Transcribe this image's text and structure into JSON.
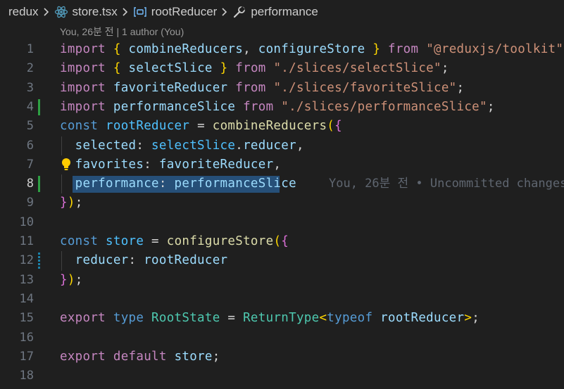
{
  "breadcrumb": {
    "items": [
      {
        "label": "redux",
        "icon": "folder"
      },
      {
        "label": "store.tsx",
        "icon": "react-icon"
      },
      {
        "label": "rootReducer",
        "icon": "variable-icon"
      },
      {
        "label": "performance",
        "icon": "wrench-icon"
      }
    ]
  },
  "codelens": "You, 26분 전 | 1 author (You)",
  "blame": "You, 26분 전 • Uncommitted changes",
  "colors": {
    "keyword": "#c586c0",
    "storage": "#569cd6",
    "variable": "#9cdcfe",
    "const": "#4fc1ff",
    "function": "#dcdcaa",
    "type": "#4ec9b0",
    "string": "#ce9178",
    "selection": "#264f78",
    "git_added": "#2ea043",
    "git_modified": "#1b81a8"
  },
  "lines": [
    {
      "n": "1",
      "tokens": [
        {
          "t": "import",
          "c": "k"
        },
        {
          "t": " ",
          "c": "p"
        },
        {
          "t": "{",
          "c": "b1"
        },
        {
          "t": " ",
          "c": "p"
        },
        {
          "t": "combineReducers",
          "c": "v"
        },
        {
          "t": ", ",
          "c": "p"
        },
        {
          "t": "configureStore",
          "c": "v"
        },
        {
          "t": " ",
          "c": "p"
        },
        {
          "t": "}",
          "c": "b1"
        },
        {
          "t": " ",
          "c": "p"
        },
        {
          "t": "from",
          "c": "k"
        },
        {
          "t": " ",
          "c": "p"
        },
        {
          "t": "\"@reduxjs/toolkit\"",
          "c": "str"
        },
        {
          "t": ";",
          "c": "p"
        }
      ]
    },
    {
      "n": "2",
      "tokens": [
        {
          "t": "import",
          "c": "k"
        },
        {
          "t": " ",
          "c": "p"
        },
        {
          "t": "{",
          "c": "b1"
        },
        {
          "t": " ",
          "c": "p"
        },
        {
          "t": "selectSlice",
          "c": "v"
        },
        {
          "t": " ",
          "c": "p"
        },
        {
          "t": "}",
          "c": "b1"
        },
        {
          "t": " ",
          "c": "p"
        },
        {
          "t": "from",
          "c": "k"
        },
        {
          "t": " ",
          "c": "p"
        },
        {
          "t": "\"./slices/selectSlice\"",
          "c": "str"
        },
        {
          "t": ";",
          "c": "p"
        }
      ]
    },
    {
      "n": "3",
      "tokens": [
        {
          "t": "import",
          "c": "k"
        },
        {
          "t": " ",
          "c": "p"
        },
        {
          "t": "favoriteReducer",
          "c": "v"
        },
        {
          "t": " ",
          "c": "p"
        },
        {
          "t": "from",
          "c": "k"
        },
        {
          "t": " ",
          "c": "p"
        },
        {
          "t": "\"./slices/favoriteSlice\"",
          "c": "str"
        },
        {
          "t": ";",
          "c": "p"
        }
      ]
    },
    {
      "n": "4",
      "decor": "added",
      "tokens": [
        {
          "t": "import",
          "c": "k"
        },
        {
          "t": " ",
          "c": "p"
        },
        {
          "t": "performanceSlice",
          "c": "v"
        },
        {
          "t": " ",
          "c": "p"
        },
        {
          "t": "from",
          "c": "k"
        },
        {
          "t": " ",
          "c": "p"
        },
        {
          "t": "\"./slices/performanceSlice\"",
          "c": "str"
        },
        {
          "t": ";",
          "c": "p"
        }
      ]
    },
    {
      "n": "5",
      "tokens": [
        {
          "t": "const",
          "c": "s"
        },
        {
          "t": " ",
          "c": "p"
        },
        {
          "t": "rootReducer",
          "c": "c"
        },
        {
          "t": " = ",
          "c": "p"
        },
        {
          "t": "combineReducers",
          "c": "f"
        },
        {
          "t": "(",
          "c": "b1"
        },
        {
          "t": "{",
          "c": "b2"
        }
      ]
    },
    {
      "n": "6",
      "guide": true,
      "tokens": [
        {
          "t": "  ",
          "c": "p"
        },
        {
          "t": "selected",
          "c": "v"
        },
        {
          "t": ": ",
          "c": "p"
        },
        {
          "t": "selectSlice",
          "c": "c"
        },
        {
          "t": ".",
          "c": "p"
        },
        {
          "t": "reducer",
          "c": "v"
        },
        {
          "t": ",",
          "c": "p"
        }
      ]
    },
    {
      "n": "7",
      "bulb": true,
      "tokens": [
        {
          "t": "  ",
          "c": "p"
        },
        {
          "t": "favorites",
          "c": "v"
        },
        {
          "t": ": ",
          "c": "p"
        },
        {
          "t": "favoriteReducer",
          "c": "v"
        },
        {
          "t": ",",
          "c": "p"
        }
      ]
    },
    {
      "n": "8",
      "decor": "added",
      "active": true,
      "selection": true,
      "blame": true,
      "guide": true,
      "tokens": [
        {
          "t": "  ",
          "c": "p"
        },
        {
          "t": "performance",
          "c": "v"
        },
        {
          "t": ": ",
          "c": "p"
        },
        {
          "t": "performanceSlice",
          "c": "v"
        }
      ]
    },
    {
      "n": "9",
      "tokens": [
        {
          "t": "}",
          "c": "b2"
        },
        {
          "t": ")",
          "c": "b1"
        },
        {
          "t": ";",
          "c": "p"
        }
      ]
    },
    {
      "n": "10",
      "tokens": []
    },
    {
      "n": "11",
      "tokens": [
        {
          "t": "const",
          "c": "s"
        },
        {
          "t": " ",
          "c": "p"
        },
        {
          "t": "store",
          "c": "c"
        },
        {
          "t": " = ",
          "c": "p"
        },
        {
          "t": "configureStore",
          "c": "f"
        },
        {
          "t": "(",
          "c": "b1"
        },
        {
          "t": "{",
          "c": "b2"
        }
      ]
    },
    {
      "n": "12",
      "decor": "modified",
      "guide": true,
      "tokens": [
        {
          "t": "  ",
          "c": "p"
        },
        {
          "t": "reducer",
          "c": "v"
        },
        {
          "t": ": ",
          "c": "p"
        },
        {
          "t": "rootReducer",
          "c": "v"
        }
      ]
    },
    {
      "n": "13",
      "tokens": [
        {
          "t": "}",
          "c": "b2"
        },
        {
          "t": ")",
          "c": "b1"
        },
        {
          "t": ";",
          "c": "p"
        }
      ]
    },
    {
      "n": "14",
      "tokens": []
    },
    {
      "n": "15",
      "tokens": [
        {
          "t": "export",
          "c": "k"
        },
        {
          "t": " ",
          "c": "p"
        },
        {
          "t": "type",
          "c": "s"
        },
        {
          "t": " ",
          "c": "p"
        },
        {
          "t": "RootState",
          "c": "t"
        },
        {
          "t": " = ",
          "c": "p"
        },
        {
          "t": "ReturnType",
          "c": "t"
        },
        {
          "t": "<",
          "c": "b1"
        },
        {
          "t": "typeof",
          "c": "s"
        },
        {
          "t": " ",
          "c": "p"
        },
        {
          "t": "rootReducer",
          "c": "v"
        },
        {
          "t": ">",
          "c": "b1"
        },
        {
          "t": ";",
          "c": "p"
        }
      ]
    },
    {
      "n": "16",
      "tokens": []
    },
    {
      "n": "17",
      "tokens": [
        {
          "t": "export",
          "c": "k"
        },
        {
          "t": " ",
          "c": "p"
        },
        {
          "t": "default",
          "c": "k"
        },
        {
          "t": " ",
          "c": "p"
        },
        {
          "t": "store",
          "c": "v"
        },
        {
          "t": ";",
          "c": "p"
        }
      ]
    },
    {
      "n": "18",
      "tokens": []
    }
  ]
}
